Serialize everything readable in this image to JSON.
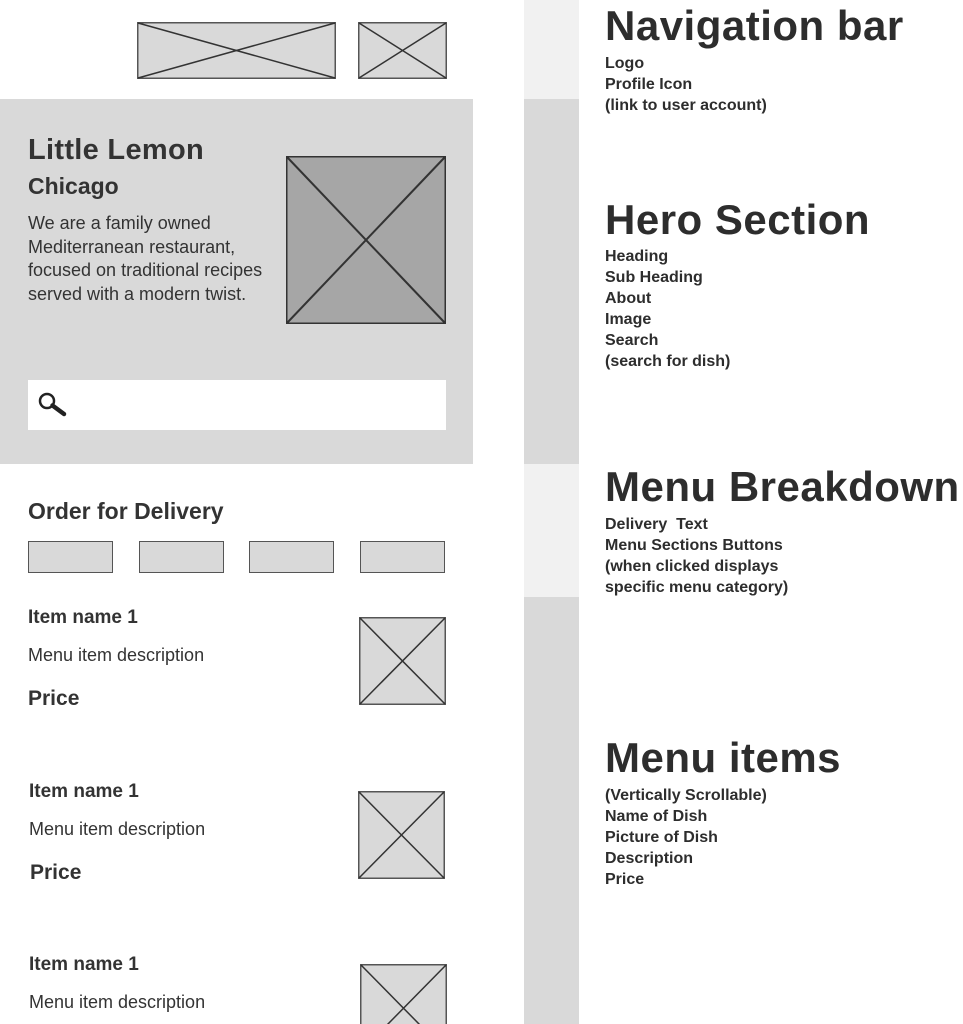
{
  "wireframe": {
    "hero": {
      "heading": "Little Lemon",
      "subheading": "Chicago",
      "about": "We are a family owned Mediterranean restaurant, focused on traditional recipes served with a modern twist."
    },
    "delivery": {
      "title": "Order for Delivery"
    },
    "menu_items": [
      {
        "name": "Item name 1",
        "description": "Menu item description",
        "price": "Price"
      },
      {
        "name": "Item name 1",
        "description": "Menu item description",
        "price": "Price"
      },
      {
        "name": "Item name 1",
        "description": "Menu item description"
      }
    ]
  },
  "annotations": {
    "navigation": {
      "title": "Navigation bar",
      "lines": [
        "Logo",
        "Profile Icon",
        "(link to user account)"
      ]
    },
    "hero": {
      "title": "Hero Section",
      "lines": [
        "Heading",
        "Sub Heading",
        "About",
        "Image",
        "Search",
        "(search for dish)"
      ]
    },
    "menu_breakdown": {
      "title": "Menu Breakdown",
      "lines": [
        "Delivery  Text",
        "Menu Sections Buttons",
        "(when clicked displays",
        "specific menu category)"
      ]
    },
    "menu_items": {
      "title": "Menu items",
      "lines": [
        "(Vertically Scrollable)",
        "Name of Dish",
        "Picture of Dish",
        "Description",
        "Price"
      ]
    }
  },
  "colors": {
    "placeholder_fill": "#d9d9d9",
    "placeholder_dark_fill": "#a6a6a6",
    "stroke": "#333333",
    "text": "#2d2d2d"
  }
}
